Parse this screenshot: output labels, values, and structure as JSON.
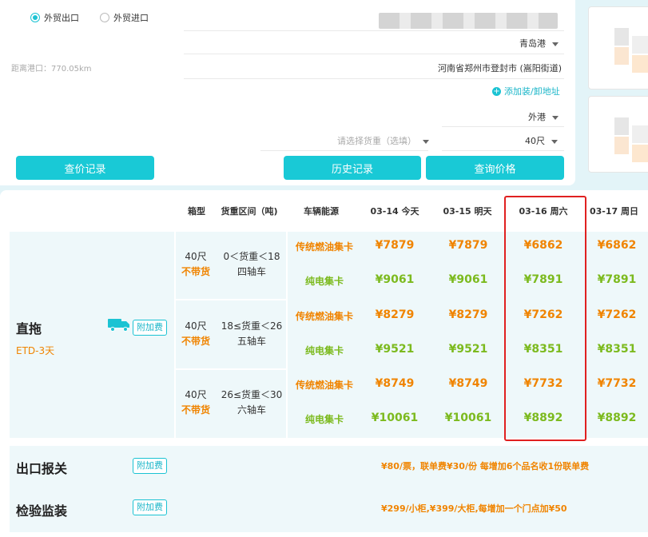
{
  "form": {
    "radio_export": "外贸出口",
    "radio_import": "外贸进口",
    "port": "青岛港",
    "distance_label": "距离港口：770.05km",
    "address": "河南省郑州市登封市 (嵩阳街道)",
    "add_address": "添加装/卸地址",
    "port_type": "外港",
    "cargo_placeholder": "请选择货重（选填）",
    "container_size": "40尺",
    "btn_price_record": "查价记录",
    "btn_history": "历史记录",
    "btn_query": "查询价格"
  },
  "table": {
    "headers": [
      "箱型",
      "货重区间（吨)",
      "车辆能源",
      "03-14 今天",
      "03-15 明天",
      "03-16 周六",
      "03-17 周日"
    ],
    "service_name": "直拖",
    "etd": "ETD-3天",
    "addon_tag": "附加费",
    "groups": [
      {
        "box": "40尺",
        "note": "不带货",
        "weight": "0＜货重＜18",
        "axle": "四轴车",
        "rows": [
          {
            "energy": "传统燃油集卡",
            "type": "fuel",
            "prices": [
              "¥7879",
              "¥7879",
              "¥6862",
              "¥6862"
            ]
          },
          {
            "energy": "纯电集卡",
            "type": "electric",
            "prices": [
              "¥9061",
              "¥9061",
              "¥7891",
              "¥7891"
            ]
          }
        ]
      },
      {
        "box": "40尺",
        "note": "不带货",
        "weight": "18≤货重＜26",
        "axle": "五轴车",
        "rows": [
          {
            "energy": "传统燃油集卡",
            "type": "fuel",
            "prices": [
              "¥8279",
              "¥8279",
              "¥7262",
              "¥7262"
            ]
          },
          {
            "energy": "纯电集卡",
            "type": "electric",
            "prices": [
              "¥9521",
              "¥9521",
              "¥8351",
              "¥8351"
            ]
          }
        ]
      },
      {
        "box": "40尺",
        "note": "不带货",
        "weight": "26≤货重＜30",
        "axle": "六轴车",
        "rows": [
          {
            "energy": "传统燃油集卡",
            "type": "fuel",
            "prices": [
              "¥8749",
              "¥8749",
              "¥7732",
              "¥7732"
            ]
          },
          {
            "energy": "纯电集卡",
            "type": "electric",
            "prices": [
              "¥10061",
              "¥10061",
              "¥8892",
              "¥8892"
            ]
          }
        ]
      }
    ]
  },
  "fees": [
    {
      "name": "出口报关",
      "tag": "附加费",
      "desc": "¥80/票，联单费¥30/份  每增加6个品名收1份联单费"
    },
    {
      "name": "检验监装",
      "tag": "附加费",
      "desc": "¥299/小柜,¥399/大柜,每增加一个门点加¥50"
    }
  ],
  "colors": {
    "accent": "#19c9d6",
    "price_fuel": "#f08400",
    "price_electric": "#7cba1e",
    "highlight": "#e02020"
  },
  "icons": {
    "truck": "truck-icon",
    "plus": "plus-icon",
    "caret": "chevron-down-icon"
  }
}
